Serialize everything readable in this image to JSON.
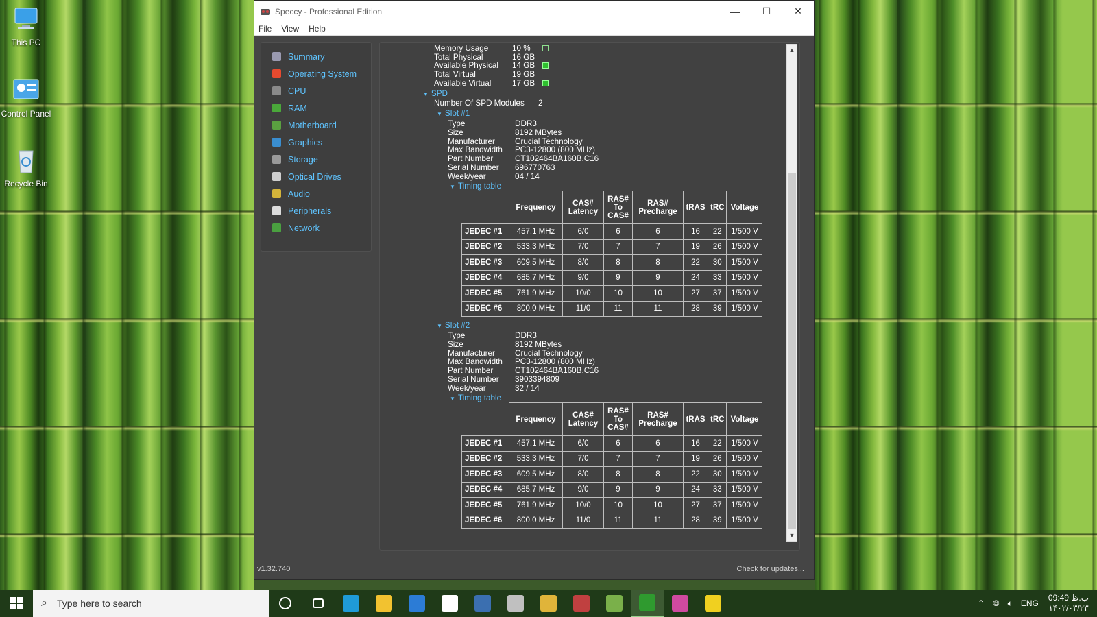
{
  "desktop": {
    "icons": [
      {
        "label": "This PC"
      },
      {
        "label": "Control Panel"
      },
      {
        "label": "Recycle Bin"
      }
    ]
  },
  "window": {
    "title": "Speccy - Professional Edition",
    "menu": [
      "File",
      "View",
      "Help"
    ]
  },
  "sidebar": {
    "items": [
      {
        "label": "Summary",
        "icon": "summary-icon",
        "color": "#9a9ab0"
      },
      {
        "label": "Operating System",
        "icon": "windows-icon",
        "color": "#e84a2f"
      },
      {
        "label": "CPU",
        "icon": "cpu-icon",
        "color": "#8a8a8a"
      },
      {
        "label": "RAM",
        "icon": "ram-icon",
        "color": "#4aa83a"
      },
      {
        "label": "Motherboard",
        "icon": "motherboard-icon",
        "color": "#5aa040"
      },
      {
        "label": "Graphics",
        "icon": "graphics-icon",
        "color": "#3a8ed0"
      },
      {
        "label": "Storage",
        "icon": "storage-icon",
        "color": "#9a9a9a"
      },
      {
        "label": "Optical Drives",
        "icon": "optical-drive-icon",
        "color": "#cfcfcf"
      },
      {
        "label": "Audio",
        "icon": "audio-icon",
        "color": "#d4b43a"
      },
      {
        "label": "Peripherals",
        "icon": "peripherals-icon",
        "color": "#dcdcdc"
      },
      {
        "label": "Network",
        "icon": "network-icon",
        "color": "#4aa040"
      }
    ]
  },
  "memory": {
    "rows": [
      {
        "label": "Memory Usage",
        "value": "10 %",
        "indicator": "empty"
      },
      {
        "label": "Total Physical",
        "value": "16 GB",
        "indicator": "none"
      },
      {
        "label": "Available Physical",
        "value": "14 GB",
        "indicator": "full"
      },
      {
        "label": "Total Virtual",
        "value": "19 GB",
        "indicator": "none"
      },
      {
        "label": "Available Virtual",
        "value": "17 GB",
        "indicator": "full"
      }
    ]
  },
  "spd": {
    "title": "SPD",
    "modules_label": "Number Of SPD Modules",
    "modules_value": "2",
    "timing_label": "Timing table",
    "table_headers": [
      "Frequency",
      "CAS#\nLatency",
      "RAS#\nTo\nCAS#",
      "RAS#\nPrecharge",
      "tRAS",
      "tRC",
      "Voltage"
    ],
    "slots": [
      {
        "title": "Slot #1",
        "fields": [
          {
            "label": "Type",
            "value": "DDR3"
          },
          {
            "label": "Size",
            "value": "8192 MBytes"
          },
          {
            "label": "Manufacturer",
            "value": "Crucial Technology"
          },
          {
            "label": "Max Bandwidth",
            "value": "PC3-12800 (800 MHz)"
          },
          {
            "label": "Part Number",
            "value": "CT102464BA160B.C16"
          },
          {
            "label": "Serial Number",
            "value": "696770763"
          },
          {
            "label": "Week/year",
            "value": "04 / 14"
          }
        ],
        "timings": [
          [
            "JEDEC #1",
            "457.1 MHz",
            "6/0",
            "6",
            "6",
            "16",
            "22",
            "1/500 V"
          ],
          [
            "JEDEC #2",
            "533.3 MHz",
            "7/0",
            "7",
            "7",
            "19",
            "26",
            "1/500 V"
          ],
          [
            "JEDEC #3",
            "609.5 MHz",
            "8/0",
            "8",
            "8",
            "22",
            "30",
            "1/500 V"
          ],
          [
            "JEDEC #4",
            "685.7 MHz",
            "9/0",
            "9",
            "9",
            "24",
            "33",
            "1/500 V"
          ],
          [
            "JEDEC #5",
            "761.9 MHz",
            "10/0",
            "10",
            "10",
            "27",
            "37",
            "1/500 V"
          ],
          [
            "JEDEC #6",
            "800.0 MHz",
            "11/0",
            "11",
            "11",
            "28",
            "39",
            "1/500 V"
          ]
        ]
      },
      {
        "title": "Slot #2",
        "fields": [
          {
            "label": "Type",
            "value": "DDR3"
          },
          {
            "label": "Size",
            "value": "8192 MBytes"
          },
          {
            "label": "Manufacturer",
            "value": "Crucial Technology"
          },
          {
            "label": "Max Bandwidth",
            "value": "PC3-12800 (800 MHz)"
          },
          {
            "label": "Part Number",
            "value": "CT102464BA160B.C16"
          },
          {
            "label": "Serial Number",
            "value": "3903394809"
          },
          {
            "label": "Week/year",
            "value": "32 / 14"
          }
        ],
        "timings": [
          [
            "JEDEC #1",
            "457.1 MHz",
            "6/0",
            "6",
            "6",
            "16",
            "22",
            "1/500 V"
          ],
          [
            "JEDEC #2",
            "533.3 MHz",
            "7/0",
            "7",
            "7",
            "19",
            "26",
            "1/500 V"
          ],
          [
            "JEDEC #3",
            "609.5 MHz",
            "8/0",
            "8",
            "8",
            "22",
            "30",
            "1/500 V"
          ],
          [
            "JEDEC #4",
            "685.7 MHz",
            "9/0",
            "9",
            "9",
            "24",
            "33",
            "1/500 V"
          ],
          [
            "JEDEC #5",
            "761.9 MHz",
            "10/0",
            "10",
            "10",
            "27",
            "37",
            "1/500 V"
          ],
          [
            "JEDEC #6",
            "800.0 MHz",
            "11/0",
            "11",
            "11",
            "28",
            "39",
            "1/500 V"
          ]
        ]
      }
    ]
  },
  "status": {
    "version": "v1.32.740",
    "update_link": "Check for updates..."
  },
  "taskbar": {
    "search_placeholder": "Type here to search",
    "language": "ENG",
    "time": "09:49 ب.ظ",
    "date": "۱۴۰۲/۰۳/۲۳",
    "apps": [
      {
        "icon": "cortana-icon",
        "color": "#ffffff"
      },
      {
        "icon": "task-view-icon",
        "color": "#ffffff"
      },
      {
        "icon": "edge-icon",
        "color": "#1f9bd8"
      },
      {
        "icon": "file-explorer-icon",
        "color": "#f2c230"
      },
      {
        "icon": "store-icon",
        "color": "#2c7cd6"
      },
      {
        "icon": "mail-icon",
        "color": "#ffffff"
      },
      {
        "icon": "calculator-icon",
        "color": "#3b6fb0"
      },
      {
        "icon": "drive-app-icon",
        "color": "#c0c0c0"
      },
      {
        "icon": "paint-icon",
        "color": "#e0b43a"
      },
      {
        "icon": "speccy-icon",
        "color": "#c04040"
      },
      {
        "icon": "motherboard-app-icon",
        "color": "#7ab04a"
      },
      {
        "icon": "xbox-icon",
        "color": "#2f9a2f"
      },
      {
        "icon": "maps-icon",
        "color": "#d04aa0"
      },
      {
        "icon": "player-icon",
        "color": "#f0d020"
      }
    ]
  }
}
